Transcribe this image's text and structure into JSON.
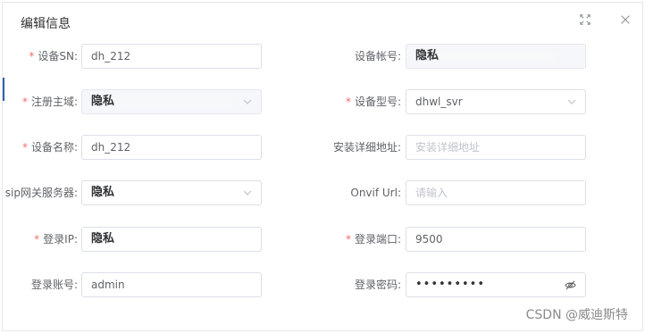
{
  "dialog": {
    "title": "编辑信息",
    "maximize_icon": "maximize-icon",
    "close_icon": "close-icon"
  },
  "form": {
    "required_mark": "*",
    "device_sn": {
      "label": "设备SN:",
      "value": "dh_212",
      "required": true
    },
    "device_account": {
      "label": "设备帐号:",
      "value": "隐私",
      "disabled": true
    },
    "register_domain": {
      "label": "注册主域:",
      "value": "隐私",
      "required": true,
      "disabled": true,
      "type": "select"
    },
    "device_model": {
      "label": "设备型号:",
      "value": "dhwl_svr",
      "required": true,
      "type": "select"
    },
    "device_name": {
      "label": "设备名称:",
      "value": "dh_212",
      "required": true
    },
    "install_address": {
      "label": "安装详细地址:",
      "placeholder": "安装详细地址",
      "value": ""
    },
    "sip_gateway": {
      "label": "sip网关服务器:",
      "value": "隐私",
      "type": "select"
    },
    "onvif_url": {
      "label": "Onvif Url:",
      "placeholder": "请输入",
      "value": ""
    },
    "login_ip": {
      "label": "登录IP:",
      "value": "隐私",
      "required": true
    },
    "login_port": {
      "label": "登录端口:",
      "value": "9500",
      "required": true
    },
    "login_account": {
      "label": "登录账号:",
      "value": "admin"
    },
    "login_password": {
      "label": "登录密码:",
      "value": "•••••••••",
      "type": "password"
    }
  },
  "watermark": "CSDN @威迪斯特"
}
